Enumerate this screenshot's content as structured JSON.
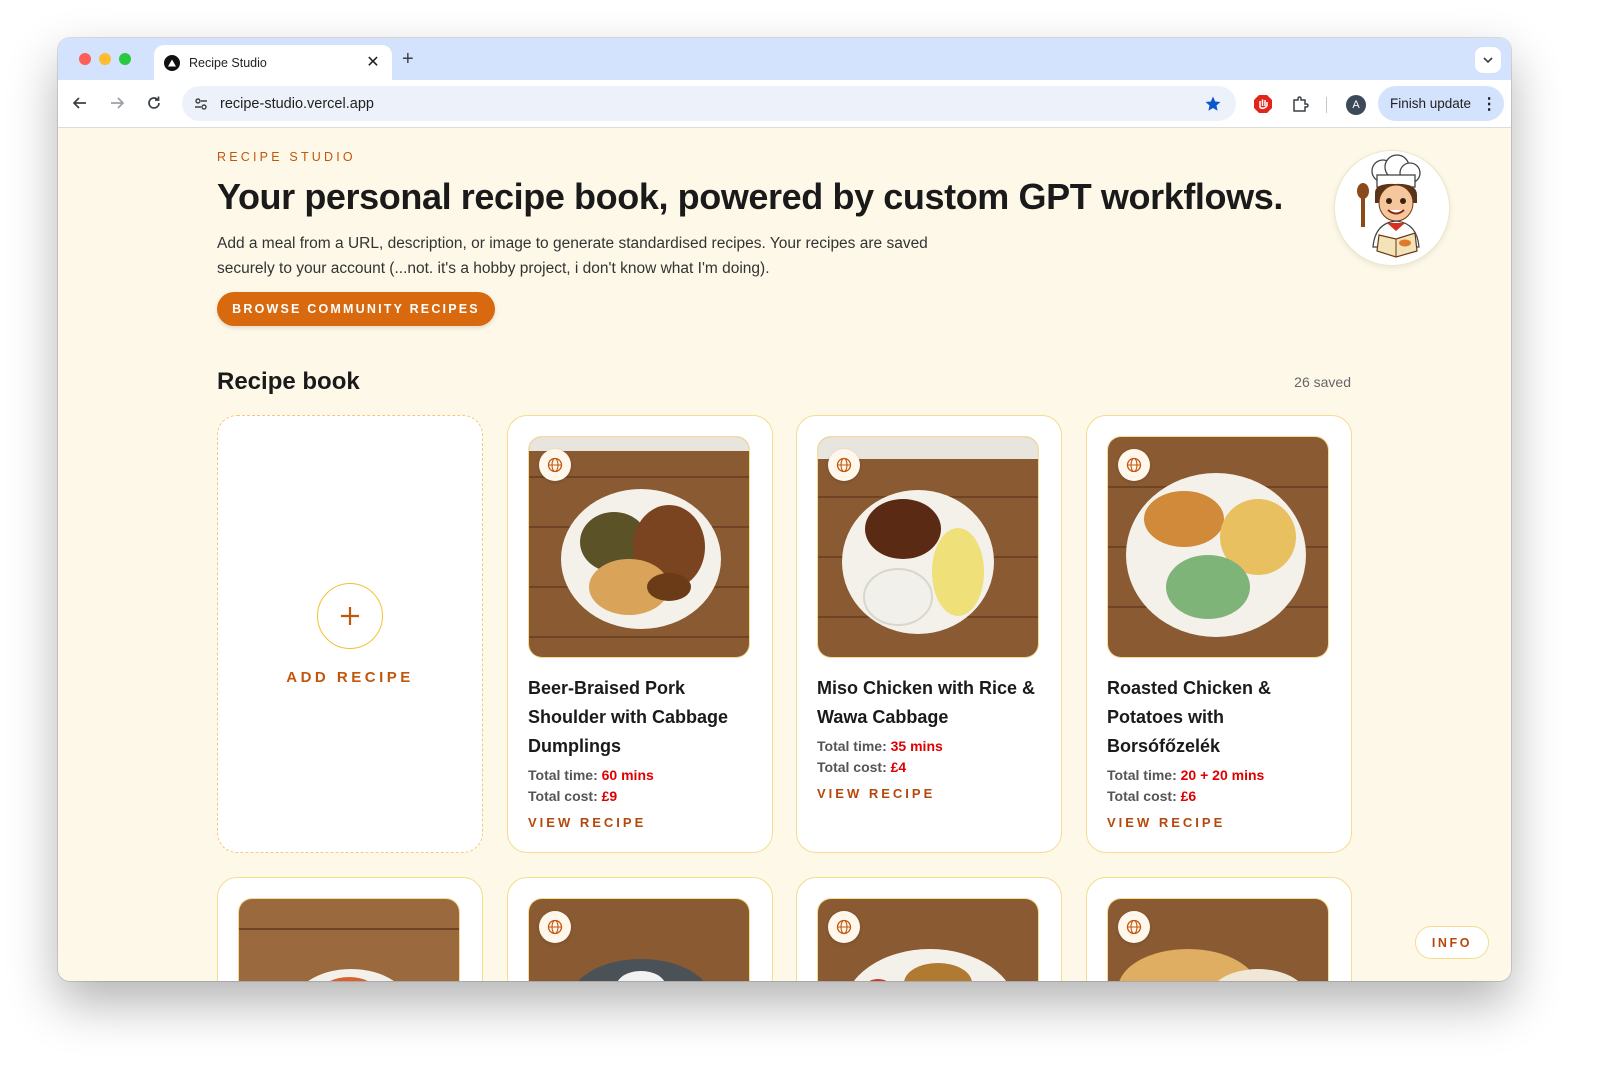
{
  "browser": {
    "tab_title": "Recipe Studio",
    "url": "recipe-studio.vercel.app",
    "update_label": "Finish update",
    "profile_initial": "A"
  },
  "hero": {
    "eyebrow": "RECIPE STUDIO",
    "headline": "Your personal recipe book, powered by custom GPT workflows.",
    "description": "Add a meal from a URL, description, or image to generate standardised recipes. Your recipes are saved securely to your account (...not. it's a hobby project, i don't know what I'm doing).",
    "browse_label": "BROWSE COMMUNITY RECIPES"
  },
  "book": {
    "title": "Recipe book",
    "saved_count": "26 saved",
    "add_label": "ADD RECIPE",
    "view_label": "VIEW RECIPE",
    "time_label": "Total time:",
    "cost_label": "Total cost:"
  },
  "recipes": [
    {
      "title": "Beer-Braised Pork Shoulder with Cabbage Dumplings",
      "time": "60 mins",
      "cost": "£9"
    },
    {
      "title": "Miso Chicken with Rice & Wawa Cabbage",
      "time": "35 mins",
      "cost": "£4"
    },
    {
      "title": "Roasted Chicken & Potatoes with Borsófőzelék",
      "time": "20 + 20 mins",
      "cost": "£6"
    }
  ],
  "info_label": "INFO",
  "colors": {
    "accent": "#d9690f",
    "accent_text": "#c2570c",
    "page_bg": "#fdf8e8",
    "value_red": "#e00000",
    "card_border": "#f5dc92"
  },
  "icons": [
    "close-icon",
    "plus-icon",
    "back-arrow-icon",
    "forward-arrow-icon",
    "reload-icon",
    "site-settings-icon",
    "star-icon",
    "adblock-icon",
    "extensions-icon",
    "globe-icon",
    "chevron-down-icon",
    "more-vert-icon"
  ]
}
